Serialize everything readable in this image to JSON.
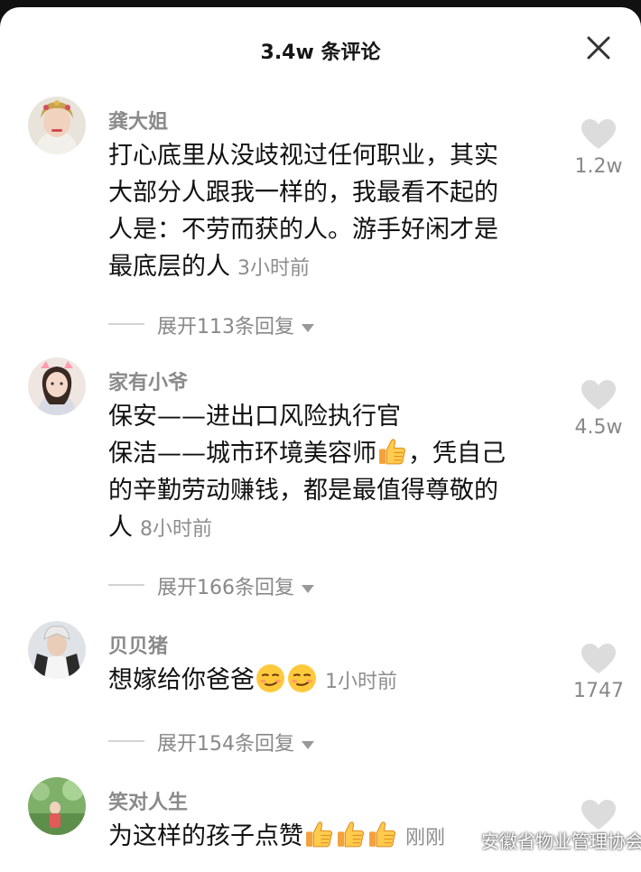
{
  "header": {
    "title": "3.4w 条评论"
  },
  "comments": [
    {
      "username": "龚大姐",
      "lines": [
        "打心底里从没歧视过任何职业，其实",
        "大部分人跟我一样的，我最看不起的",
        "人是：不劳而获的人。游手好闲才是",
        "最底层的人"
      ],
      "time": "3小时前",
      "likes": "1.2w",
      "replies": "展开113条回复"
    },
    {
      "username": "家有小爷",
      "lines": [
        "保安——进出口风险执行官",
        "保洁——城市环境美容师",
        "，凭自己",
        "的辛勤劳动赚钱，都是最值得尊敬的",
        "人"
      ],
      "time": "8小时前",
      "likes": "4.5w",
      "replies": "展开166条回复"
    },
    {
      "username": "贝贝猪",
      "lines": [
        "想嫁给你爸爸"
      ],
      "time": "1小时前",
      "likes": "1747",
      "replies": "展开154条回复"
    },
    {
      "username": "笑对人生",
      "lines": [
        "为这样的孩子点赞"
      ],
      "time": "刚刚",
      "likes": ""
    }
  ],
  "icons": {
    "close": "close-icon",
    "like": "heart-icon",
    "expand": "caret-down-icon",
    "thumbs": "thumbs-up-emoji",
    "smirk": "smirk-emoji"
  },
  "watermark": {
    "text": "安徽省物业管理协会"
  },
  "colors": {
    "background": "#ffffff",
    "username": "#8a8a8a",
    "body_text": "#111111",
    "meta": "#888888",
    "heart": "#dcdcdc"
  }
}
